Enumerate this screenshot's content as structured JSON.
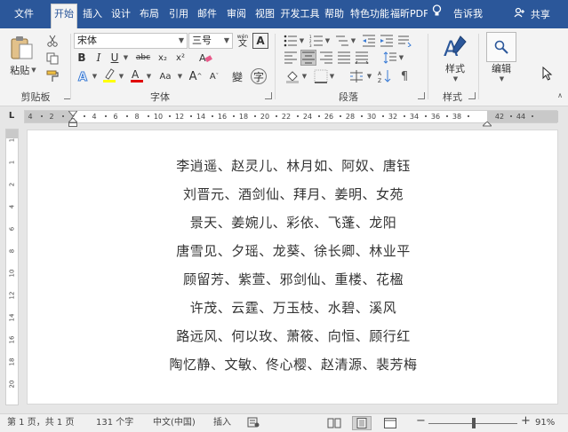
{
  "menu": {
    "tabs": [
      "文件",
      "开始",
      "插入",
      "设计",
      "布局",
      "引用",
      "邮件",
      "审阅",
      "视图",
      "开发工具",
      "帮助",
      "特色功能",
      "福昕PDF"
    ],
    "tell_me": "告诉我",
    "share": "共享"
  },
  "ribbon": {
    "clipboard": {
      "label": "剪贴板",
      "paste": "粘贴"
    },
    "font": {
      "label": "字体",
      "font_name": "宋体",
      "font_size": "三号",
      "wen": "wén",
      "change_case": "Aa",
      "bold": "B",
      "italic": "I",
      "underline": "U",
      "strike": "abc",
      "subscript": "x₂",
      "superscript": "x²",
      "font_color_A": "A",
      "highlight_color": "#ffff00",
      "font_color": "#e00000"
    },
    "paragraph": {
      "label": "段落"
    },
    "styles": {
      "label": "样式",
      "button": "样式"
    },
    "editing": {
      "button": "编辑"
    }
  },
  "ruler": {
    "corner": "L",
    "ticks": [
      "4",
      "2",
      "2",
      "4",
      "6",
      "8",
      "10",
      "12",
      "14",
      "16",
      "18",
      "20",
      "22",
      "24",
      "26",
      "28",
      "30",
      "32",
      "34",
      "36",
      "38",
      "42",
      "44"
    ],
    "vticks": [
      "1",
      "1",
      "2",
      "4",
      "6",
      "8",
      "10",
      "12",
      "14",
      "16",
      "18",
      "20"
    ]
  },
  "document": {
    "lines": [
      "李逍遥、赵灵儿、林月如、阿奴、唐钰",
      "刘晋元、酒剑仙、拜月、姜明、女苑",
      "景天、姜婉儿、彩依、飞蓬、龙阳",
      "唐雪见、夕瑶、龙葵、徐长卿、林业平",
      "顾留芳、紫萱、邪剑仙、重楼、花楹",
      "许茂、云霆、万玉枝、水碧、溪风",
      "路远风、何以玫、萧筱、向恒、顾行红",
      "陶忆静、文敏、佟心樱、赵清源、裴芳梅"
    ]
  },
  "status": {
    "page": "第 1 页，共 1 页",
    "words": "131 个字",
    "language": "中文(中国)",
    "insert": "插入",
    "zoom": "91%",
    "zoom_minus": "−",
    "zoom_plus": "+",
    "zoom_fraction": 0.51
  }
}
